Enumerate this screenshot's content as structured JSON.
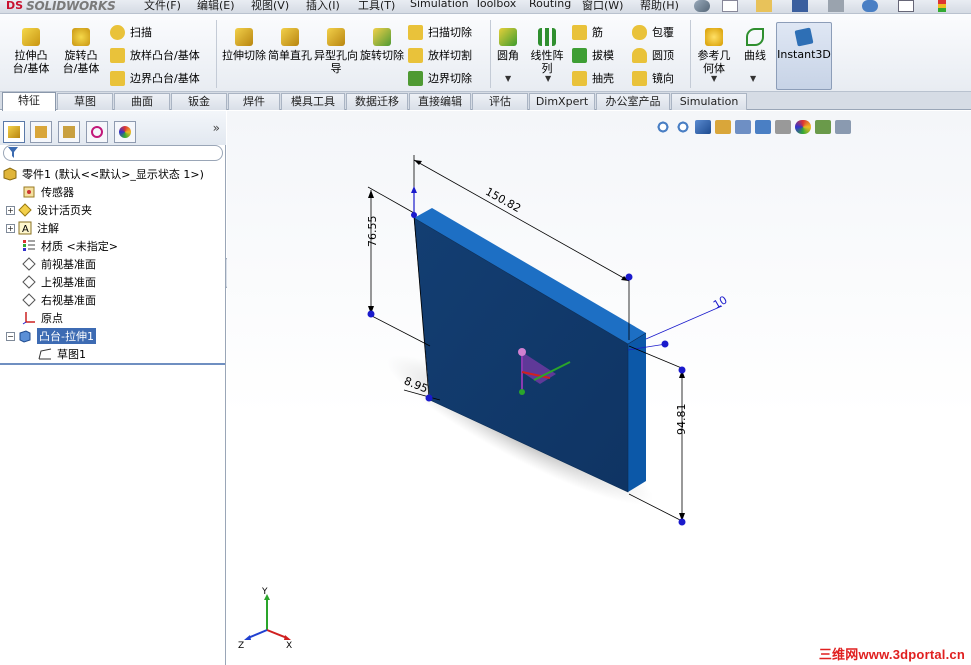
{
  "app": {
    "brand": "SOLIDWORKS",
    "brand_prefix": "DS"
  },
  "menu": [
    "文件(F)",
    "编辑(E)",
    "视图(V)",
    "插入(I)",
    "工具(T)",
    "Simulation",
    "Toolbox",
    "Routing",
    "窗口(W)",
    "帮助(H)"
  ],
  "commands": {
    "extrude_boss": "拉伸凸台/基体",
    "revolve_boss": "旋转凸台/基体",
    "sweep": "扫描",
    "loft_boss": "放样凸台/基体",
    "boundary_boss": "边界凸台/基体",
    "extrude_cut": "拉伸切除",
    "simple_hole": "简单直孔",
    "hole_wizard": "异型孔向导",
    "revolve_cut": "旋转切除",
    "swept_cut": "扫描切除",
    "lofted_cut": "放样切割",
    "boundary_cut": "边界切除",
    "fillet": "圆角",
    "linear_pattern": "线性阵列",
    "rib": "筋",
    "draft": "拔模",
    "shell": "抽壳",
    "wrap": "包覆",
    "dome": "圆顶",
    "mirror": "镜向",
    "reference_geometry": "参考几何体",
    "curves": "曲线",
    "instant3d": "Instant3D"
  },
  "tabs": [
    "特征",
    "草图",
    "曲面",
    "钣金",
    "焊件",
    "模具工具",
    "数据迁移",
    "直接编辑",
    "评估",
    "DimXpert",
    "办公室产品",
    "Simulation"
  ],
  "tree": {
    "root": "零件1  (默认<<默认>_显示状态 1>)",
    "items": [
      "传感器",
      "设计活页夹",
      "注解",
      "材质 <未指定>",
      "前视基准面",
      "上视基准面",
      "右视基准面",
      "原点",
      "凸台-拉伸1",
      "草图1"
    ]
  },
  "dimensions": {
    "length": "150.82",
    "height_left": "76.55",
    "thickness": "10",
    "height_right": "94.81",
    "offset": "8.95"
  },
  "triad": {
    "x": "X",
    "y": "Y",
    "z": "Z"
  },
  "watermark": "三维网www.3dportal.cn",
  "colors": {
    "part": "#0e5aa7",
    "part_side": "#0a4a8c",
    "part_face": "#123b6c",
    "dimension": "#000000",
    "selection": "#1a1acc"
  }
}
